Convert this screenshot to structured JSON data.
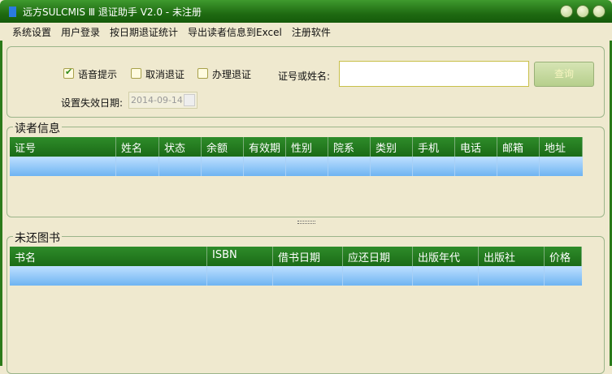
{
  "window": {
    "title": "远方SULCMIS Ⅲ 退证助手 V2.0 - 未注册"
  },
  "menu": [
    "系统设置",
    "用户登录",
    "按日期退证统计",
    "导出读者信息到Excel",
    "注册软件"
  ],
  "options": {
    "voice": "语音提示",
    "voice_checked": true,
    "cancel": "取消退证",
    "cancel_checked": false,
    "handle": "办理退证",
    "handle_checked": false
  },
  "search": {
    "label": "证号或姓名:",
    "value": "",
    "button": "查询"
  },
  "expiry": {
    "label": "设置失效日期:",
    "value": "2014-09-14"
  },
  "reader": {
    "title": "读者信息",
    "columns": [
      "证号",
      "姓名",
      "状态",
      "余额",
      "有效期",
      "性别",
      "院系",
      "类别",
      "手机",
      "电话",
      "邮箱",
      "地址"
    ]
  },
  "books": {
    "title": "未还图书",
    "columns": [
      "书名",
      "ISBN",
      "借书日期",
      "应还日期",
      "出版年代",
      "出版社",
      "价格"
    ]
  }
}
